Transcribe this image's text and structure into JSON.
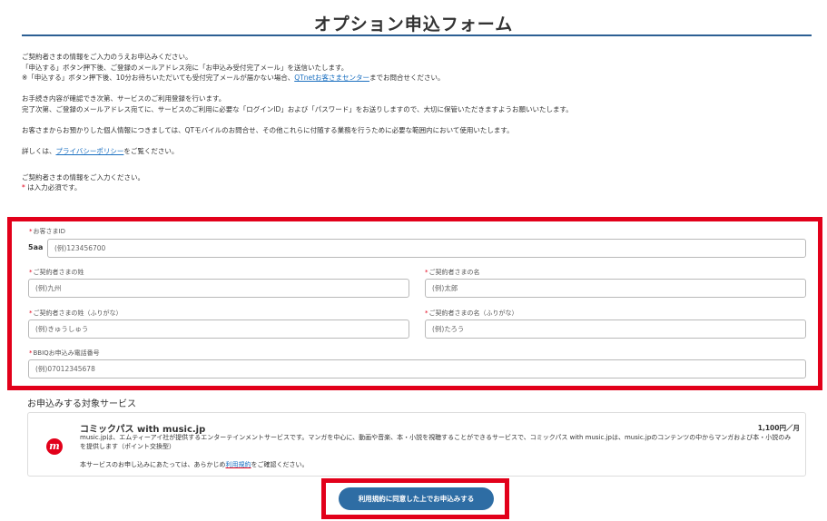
{
  "page": {
    "title": "オプション申込フォーム"
  },
  "intro": {
    "line1": "ご契約者さまの情報をご入力のうえお申込みください。",
    "line2": "「申込する」ボタン押下後、ご登録のメールアドレス宛に「お申込み受付完了メール」を送信いたします。",
    "line3_pre": "※「申込する」ボタン押下後、10分お待ちいただいても受付完了メールが届かない場合、",
    "line3_link": "QTnetお客さまセンター",
    "line3_post": "までお問合せください。",
    "line4": "お手続き内容が確認でき次第、サービスのご利用登録を行います。",
    "line5": "完了次第、ご登録のメールアドレス宛てに、サービスのご利用に必要な「ログインID」および「パスワード」をお送りしますので、大切に保管いただきますようお願いいたします。",
    "line6": "お客さまからお預かりした個人情報につきましては、QTモバイルのお問合せ、その他これらに付随する業務を行うために必要な範囲内において使用いたします。",
    "line7_pre": "詳しくは、",
    "line7_link": "プライバシーポリシー",
    "line7_post": "をご覧ください。",
    "line8": "ご契約者さまの情報をご入力ください。",
    "line9_mark": "*",
    "line9_text": " は入力必須です。"
  },
  "form": {
    "required_mark": "*",
    "customer_id": {
      "label": "お客さまID",
      "prefix": "5aa",
      "placeholder": "(例)123456700"
    },
    "last_name": {
      "label": "ご契約者さまの姓",
      "placeholder": "(例)九州"
    },
    "first_name": {
      "label": "ご契約者さまの名",
      "placeholder": "(例)太郎"
    },
    "last_name_kana": {
      "label": "ご契約者さまの姓（ふりがな）",
      "placeholder": "(例)きゅうしゅう"
    },
    "first_name_kana": {
      "label": "ご契約者さまの名（ふりがな）",
      "placeholder": "(例)たろう"
    },
    "phone": {
      "label": "BBIQお申込み電話番号",
      "placeholder": "(例)07012345678"
    }
  },
  "service": {
    "heading": "お申込みする対象サービス",
    "logo_letter": "m",
    "name": "コミックパス with music.jp",
    "price": "1,100円／月",
    "description": "music.jpは、エムティーアイ社が提供するエンターテインメントサービスです。マンガを中心に、動画や音楽、本・小説を視聴することができるサービスで、コミックパス with music.jpは、music.jpのコンテンツの中からマンガおよび本・小説のみを提供します（ポイント交換型）",
    "note_pre": "本サービスのお申し込みにあたっては、あらかじめ",
    "note_link": "利用規約",
    "note_post": "をご確認ください。"
  },
  "actions": {
    "submit_label": "利用規約に同意した上でお申込みする"
  },
  "colors": {
    "accent": "#2e6da4",
    "highlight_frame": "#e2001a",
    "link": "#1a6fc0"
  }
}
